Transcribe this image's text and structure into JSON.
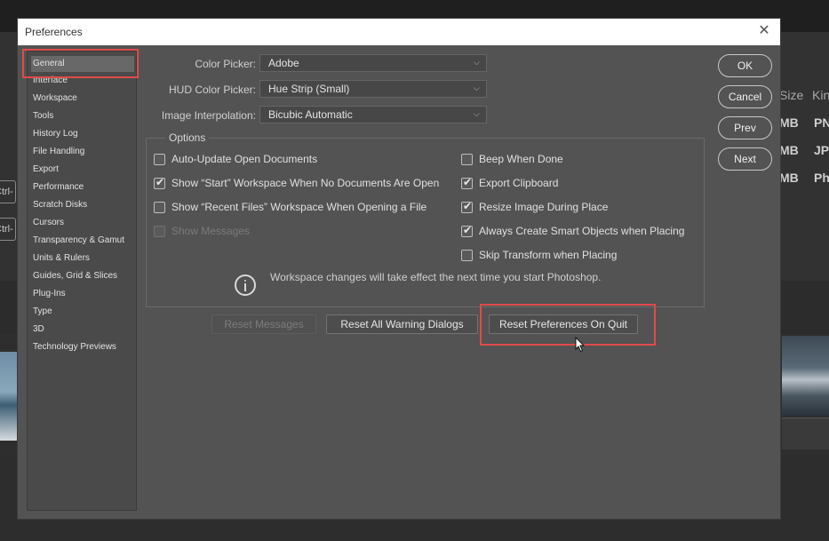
{
  "background": {
    "col_size_header": "Size",
    "col_kind_header": "Kin",
    "rows": [
      {
        "size": "MB",
        "kind": "PN"
      },
      {
        "size": "MB",
        "kind": "JPE"
      },
      {
        "size": "MB",
        "kind": "Ph"
      }
    ],
    "ctrl_labels": [
      "Ctrl-",
      "Ctrl-"
    ]
  },
  "dialog": {
    "title": "Preferences",
    "close_icon": "close-icon"
  },
  "sidebar": {
    "items": [
      {
        "label": "General",
        "active": true
      },
      {
        "label": "Interface"
      },
      {
        "label": "Workspace"
      },
      {
        "label": "Tools"
      },
      {
        "label": "History Log"
      },
      {
        "label": "File Handling"
      },
      {
        "label": "Export"
      },
      {
        "label": "Performance"
      },
      {
        "label": "Scratch Disks"
      },
      {
        "label": "Cursors"
      },
      {
        "label": "Transparency & Gamut"
      },
      {
        "label": "Units & Rulers"
      },
      {
        "label": "Guides, Grid & Slices"
      },
      {
        "label": "Plug-Ins"
      },
      {
        "label": "Type"
      },
      {
        "label": "3D"
      },
      {
        "label": "Technology Previews"
      }
    ]
  },
  "fields": {
    "color_picker": {
      "label": "Color Picker:",
      "value": "Adobe"
    },
    "hud_color_picker": {
      "label": "HUD Color Picker:",
      "value": "Hue Strip (Small)"
    },
    "image_interpolation": {
      "label": "Image Interpolation:",
      "value": "Bicubic Automatic"
    }
  },
  "options": {
    "label": "Options",
    "left": [
      {
        "label": "Auto-Update Open Documents",
        "checked": false,
        "enabled": true
      },
      {
        "label": "Show “Start” Workspace When No Documents Are Open",
        "checked": true,
        "enabled": true
      },
      {
        "label": "Show “Recent Files” Workspace When Opening a File",
        "checked": false,
        "enabled": true
      },
      {
        "label": "Show Messages",
        "checked": false,
        "enabled": false
      }
    ],
    "right": [
      {
        "label": "Beep When Done",
        "checked": false,
        "enabled": true
      },
      {
        "label": "Export Clipboard",
        "checked": true,
        "enabled": true
      },
      {
        "label": "Resize Image During Place",
        "checked": true,
        "enabled": true
      },
      {
        "label": "Always Create Smart Objects when Placing",
        "checked": true,
        "enabled": true
      },
      {
        "label": "Skip Transform when Placing",
        "checked": false,
        "enabled": true
      }
    ],
    "info_text": "Workspace changes will take effect the next time you start Photoshop."
  },
  "reset_buttons": {
    "reset_messages": "Reset Messages",
    "reset_warnings": "Reset All Warning Dialogs",
    "reset_prefs": "Reset Preferences On Quit"
  },
  "side_buttons": {
    "ok": "OK",
    "cancel": "Cancel",
    "prev": "Prev",
    "next": "Next"
  },
  "colors": {
    "highlight": "#e04a4a",
    "dialog_bg": "#535353"
  }
}
